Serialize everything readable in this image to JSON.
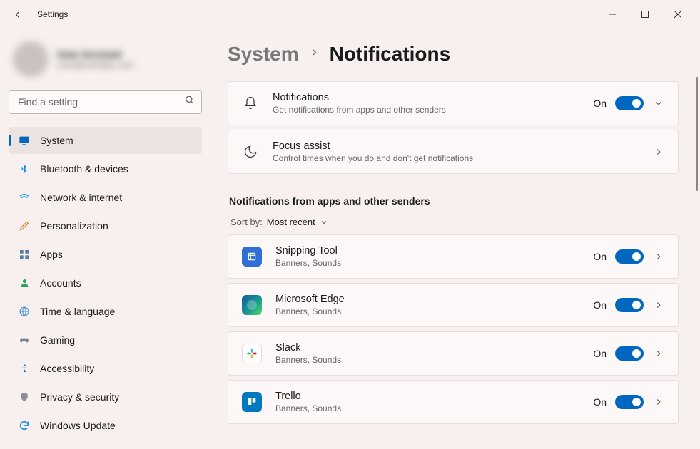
{
  "window": {
    "title": "Settings"
  },
  "user": {
    "name": "User Account",
    "email": "user@example.com"
  },
  "search": {
    "placeholder": "Find a setting"
  },
  "sidebar": {
    "items": [
      {
        "label": "System",
        "icon": "system",
        "color": "#0067c0",
        "active": true
      },
      {
        "label": "Bluetooth & devices",
        "icon": "bluetooth",
        "color": "#1b8fe6"
      },
      {
        "label": "Network & internet",
        "icon": "wifi",
        "color": "#1aa0d8"
      },
      {
        "label": "Personalization",
        "icon": "brush",
        "color": "#d08a2a"
      },
      {
        "label": "Apps",
        "icon": "apps",
        "color": "#5a7a9e"
      },
      {
        "label": "Accounts",
        "icon": "person",
        "color": "#2aa35a"
      },
      {
        "label": "Time & language",
        "icon": "globe",
        "color": "#3a8dd0"
      },
      {
        "label": "Gaming",
        "icon": "gaming",
        "color": "#7a7f88"
      },
      {
        "label": "Accessibility",
        "icon": "access",
        "color": "#2a6fb0"
      },
      {
        "label": "Privacy & security",
        "icon": "shield",
        "color": "#8a8f95"
      },
      {
        "label": "Windows Update",
        "icon": "update",
        "color": "#1a8fd6"
      }
    ]
  },
  "breadcrumb": {
    "parent": "System",
    "current": "Notifications"
  },
  "cards": {
    "notifications": {
      "title": "Notifications",
      "sub": "Get notifications from apps and other senders",
      "state": "On"
    },
    "focus": {
      "title": "Focus assist",
      "sub": "Control times when you do and don't get notifications"
    }
  },
  "section_header": "Notifications from apps and other senders",
  "sort": {
    "label": "Sort by:",
    "value": "Most recent"
  },
  "apps": [
    {
      "name": "Snipping Tool",
      "sub": "Banners, Sounds",
      "state": "On",
      "icon_color": "#2f6fd6"
    },
    {
      "name": "Microsoft Edge",
      "sub": "Banners, Sounds",
      "state": "On",
      "icon_color": "#1a9f8a"
    },
    {
      "name": "Slack",
      "sub": "Banners, Sounds",
      "state": "On",
      "icon_color": "#ffffff"
    },
    {
      "name": "Trello",
      "sub": "Banners, Sounds",
      "state": "On",
      "icon_color": "#0079bf"
    }
  ]
}
